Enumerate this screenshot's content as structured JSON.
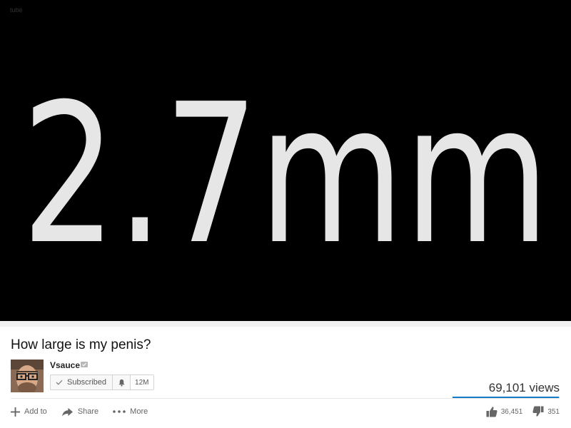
{
  "player": {
    "watermark": "tube",
    "frame_text": "2.7mm",
    "background_color": "#000000",
    "text_color": "#e6e6e6"
  },
  "video": {
    "title": "How large is my penis?"
  },
  "channel": {
    "name": "Vsauce",
    "verified_icon": "verified-badge-icon",
    "avatar_icon": "channel-avatar"
  },
  "subscribe": {
    "label": "Subscribed",
    "check_icon": "check-icon",
    "bell_icon": "bell-icon",
    "count": "12M"
  },
  "stats": {
    "views": "69,101 views",
    "likes": "36,451",
    "dislikes": "351",
    "like_ratio": 0.99,
    "accent_color": "#167ac6"
  },
  "actions": {
    "add_to": "Add to",
    "share": "Share",
    "more": "More"
  }
}
